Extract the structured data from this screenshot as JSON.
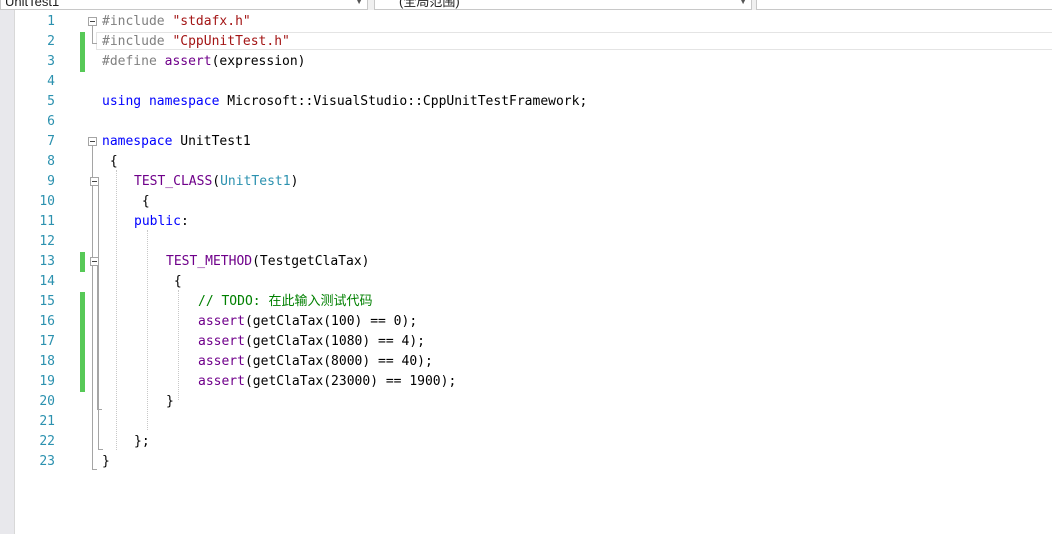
{
  "toolbar": {
    "project_dropdown": "UnitTest1",
    "scope_dropdown": "(全局范围)"
  },
  "editor": {
    "line_numbers": [
      "1",
      "2",
      "3",
      "4",
      "5",
      "6",
      "7",
      "8",
      "9",
      "10",
      "11",
      "12",
      "13",
      "14",
      "15",
      "16",
      "17",
      "18",
      "19",
      "20",
      "21",
      "22",
      "23"
    ],
    "lines": {
      "l1_pp": "#include ",
      "l1_str": "\"stdafx.h\"",
      "l2_pp": "#include ",
      "l2_str": "\"CppUnitTest.h\"",
      "l3_pp": "#define ",
      "l3_mac": "assert",
      "l3_rest": "(expression)",
      "l5_kw1": "using",
      "l5_kw2": "namespace",
      "l5_rest": "Microsoft::VisualStudio::CppUnitTestFramework;",
      "l7_kw": "namespace",
      "l7_rest": " UnitTest1",
      "l8": "{",
      "l9_mac": "TEST_CLASS",
      "l9_p1": "(",
      "l9_typ": "UnitTest1",
      "l9_p2": ")",
      "l10": "{",
      "l11_kw": "public",
      "l11_rest": ":",
      "l13_mac": "TEST_METHOD",
      "l13_rest": "(TestgetClaTax)",
      "l14": "{",
      "l15_com": "// TODO: 在此输入测试代码",
      "l16_mac": "assert",
      "l16_rest": "(getClaTax(100) == 0);",
      "l17_mac": "assert",
      "l17_rest": "(getClaTax(1080) == 4);",
      "l18_mac": "assert",
      "l18_rest": "(getClaTax(8000) == 40);",
      "l19_mac": "assert",
      "l19_rest": "(getClaTax(23000) == 1900);",
      "l20": "}",
      "l22": "};",
      "l23": "}"
    }
  },
  "colors": {
    "keyword": "#0000ff",
    "macro": "#6f008a",
    "string": "#a31515",
    "comment": "#008000",
    "type": "#2b91af",
    "line_number": "#2b91af",
    "change_marker": "#57c957"
  }
}
